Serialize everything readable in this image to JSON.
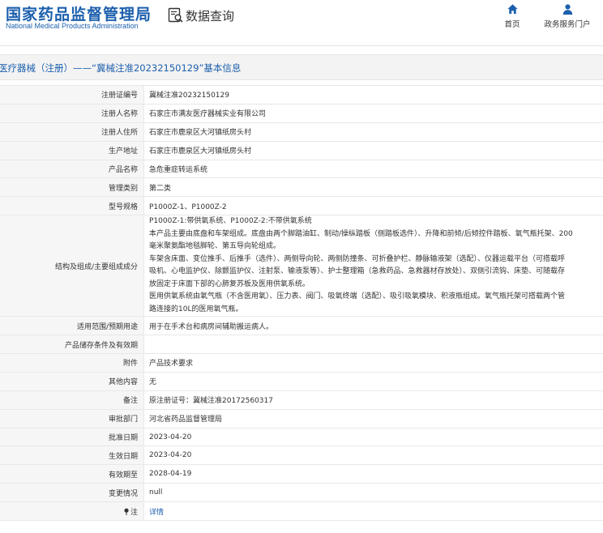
{
  "header": {
    "brand_cn": "国家药品监督管理局",
    "brand_en": "National Medical Products Administration",
    "section_title": "数据查询",
    "nav": {
      "home": "首页",
      "portal": "政务服务门户"
    }
  },
  "colors": {
    "brand": "#1c5fad",
    "label_bg": "#f6f6f6",
    "title_bg": "#f3f3f3"
  },
  "page": {
    "title": "医疗器械（注册）——“冀械注准20232150129”基本信息"
  },
  "details": {
    "reg_no": {
      "label": "注册证编号",
      "value": "冀械注准20232150129"
    },
    "registrant": {
      "label": "注册人名称",
      "value": "石家庄市满友医疗器械实业有限公司"
    },
    "registrant_address": {
      "label": "注册人住所",
      "value": "石家庄市鹿泉区大河镇纸房头村"
    },
    "production_address": {
      "label": "生产地址",
      "value": "石家庄市鹿泉区大河镇纸房头村"
    },
    "product_name": {
      "label": "产品名称",
      "value": "急危重症转运系统"
    },
    "category": {
      "label": "管理类别",
      "value": "第二类"
    },
    "model": {
      "label": "型号规格",
      "value": "P1000Z-1、P1000Z-2"
    },
    "structure": {
      "label": "结构及组成/主要组成成分",
      "lines": [
        "P1000Z-1:带供氧系统、P1000Z-2:不带供氧系统",
        "本产品主要由底盘和车架组成。底盘由两个脚踏油缸、制动/操纵踏板（侧踏板选件）、升降和前倾/后倾控件踏板、氧气瓶托架、200",
        "毫米聚氨酯地毯脚轮、第五导向轮组成。",
        "车架含床面、变位推手、后推手（选件）、两侧导向轮、两侧防撞条、可折叠护栏、静脉输液架（选配）、仪器运载平台（可搭载呼",
        "吸机、心电监护仪、除颤监护仪、注射泵、输液泵等）、护士整理箱（急救药品、急救器材存放处）、双侧引流钩、床垫、可随载存",
        "放固定于床面下部的心肺复苏板及医用供氧系统。",
        "医用供氧系统由氧气瓶（不含医用氧）、压力表、阀门、吸氧终端（选配）、吸引吸氧模块、积液瓶组成。氧气瓶托架可搭载两个管",
        "路连接的10L的医用氧气瓶。"
      ]
    },
    "scope": {
      "label": "适用范围/预期用途",
      "value": "用于在手术台和病房间辅助搬运病人。"
    },
    "storage": {
      "label": "产品储存条件及有效期",
      "value": ""
    },
    "attachment": {
      "label": "附件",
      "value": "产品技术要求"
    },
    "other": {
      "label": "其他内容",
      "value": "无"
    },
    "remark": {
      "label": "备注",
      "value": "原注册证号：冀械注准20172560317"
    },
    "approval_dept": {
      "label": "审批部门",
      "value": "河北省药品监督管理局"
    },
    "approval_date": {
      "label": "批准日期",
      "value": "2023-04-20"
    },
    "effective_date": {
      "label": "生效日期",
      "value": "2023-04-20"
    },
    "expiry_date": {
      "label": "有效期至",
      "value": "2028-04-19"
    },
    "change": {
      "label": "变更情况",
      "value": "null"
    },
    "note": {
      "label": "注",
      "value": "详情"
    }
  }
}
